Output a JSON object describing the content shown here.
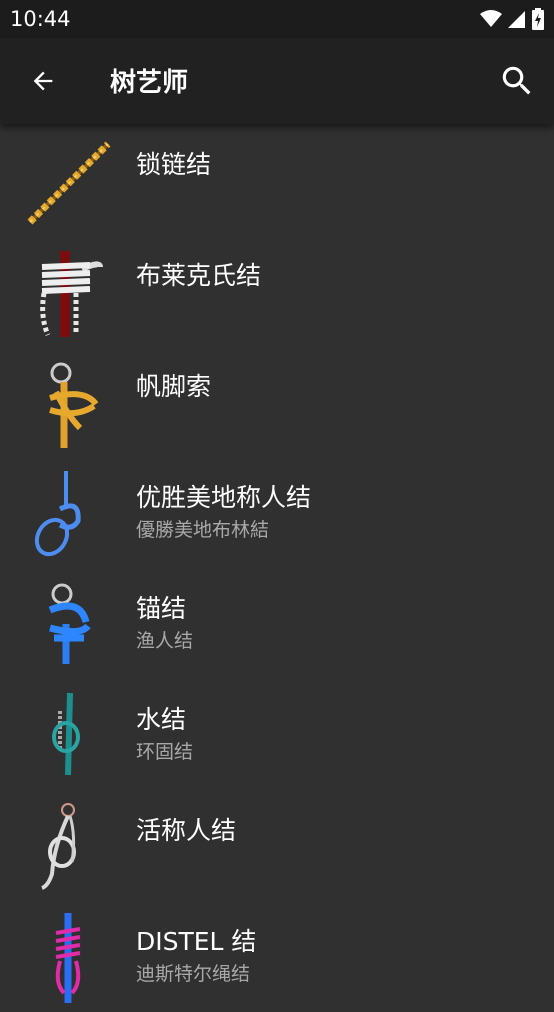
{
  "status_bar": {
    "time": "10:44"
  },
  "app_bar": {
    "title": "树艺师"
  },
  "knots": [
    {
      "name": "锁链结",
      "alt": ""
    },
    {
      "name": "布莱克氏结",
      "alt": ""
    },
    {
      "name": "帆脚索",
      "alt": ""
    },
    {
      "name": "优胜美地称人结",
      "alt": "優勝美地布林結"
    },
    {
      "name": "锚结",
      "alt": "渔人结"
    },
    {
      "name": "水结",
      "alt": "环固结"
    },
    {
      "name": "活称人结",
      "alt": ""
    },
    {
      "name": "DISTEL 结",
      "alt": "迪斯特尔绳结"
    }
  ],
  "colors": {
    "background": "#303030",
    "app_bar": "#212121",
    "status_bar": "#1c1c1c",
    "secondary_text": "#a8a8a8"
  }
}
